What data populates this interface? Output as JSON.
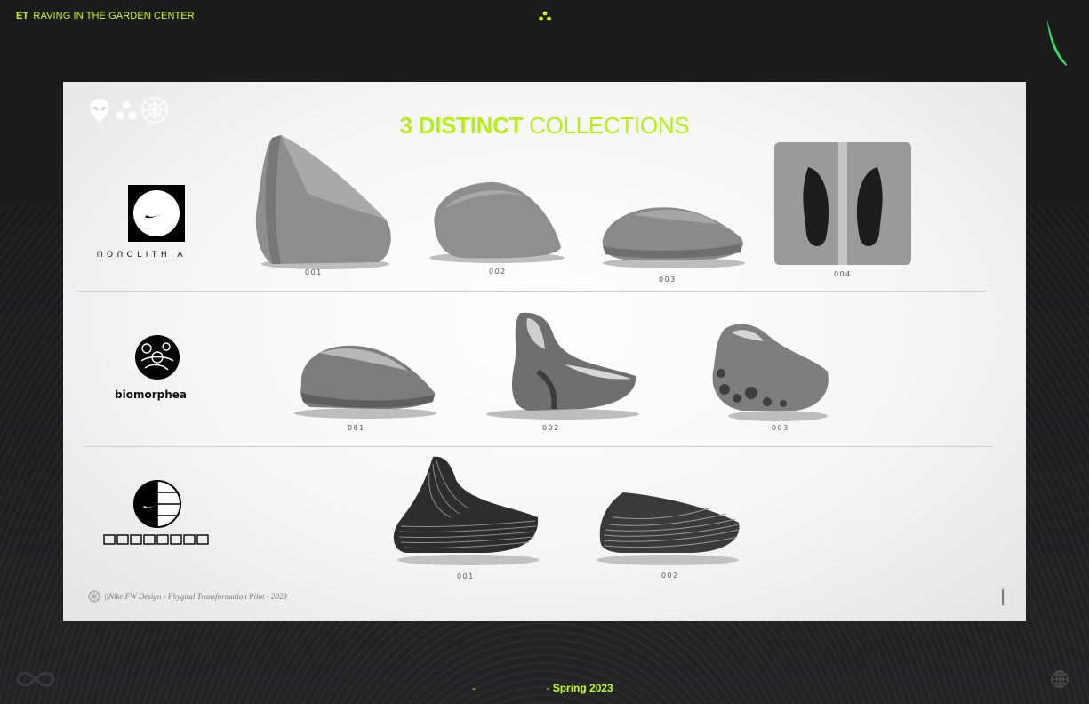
{
  "header": {
    "brand": "ET",
    "title": "RAVING IN THE GARDEN CENTER",
    "dots_icon": "three-dots-icon",
    "swoosh_icon": "swoosh-icon"
  },
  "slide": {
    "title_bold": "3 DISTINCT",
    "title_light": "COLLECTIONS",
    "header_icons": [
      "alien-icon",
      "three-dots-icon",
      "geodesic-sphere-icon"
    ],
    "footer_text": "||Nike FW Design - Phygital Transformation Pilot - 2023",
    "collections": [
      {
        "name": "MONOLITHIA",
        "logo_icon": "monolithia-logo",
        "shoes": [
          {
            "label": "001"
          },
          {
            "label": "002"
          },
          {
            "label": "003"
          },
          {
            "label": "004"
          }
        ]
      },
      {
        "name": "BIOMORPHEA",
        "logo_icon": "biomorphea-logo",
        "shoes": [
          {
            "label": "001"
          },
          {
            "label": "002"
          },
          {
            "label": "003"
          }
        ]
      },
      {
        "name": "PARAMETRA",
        "logo_icon": "parametra-logo",
        "shoes": [
          {
            "label": "001"
          },
          {
            "label": "002"
          }
        ]
      }
    ]
  },
  "bottom": {
    "dash1": "-",
    "dash2": "-",
    "season": "Spring 2023",
    "left_icon": "infinity-icon",
    "right_icon": "globe-icon"
  },
  "colors": {
    "accent": "#c8ff00",
    "title_green": "#b6ef17",
    "background": "#1b1b1c",
    "slide_bg": "#f5f5f5"
  }
}
